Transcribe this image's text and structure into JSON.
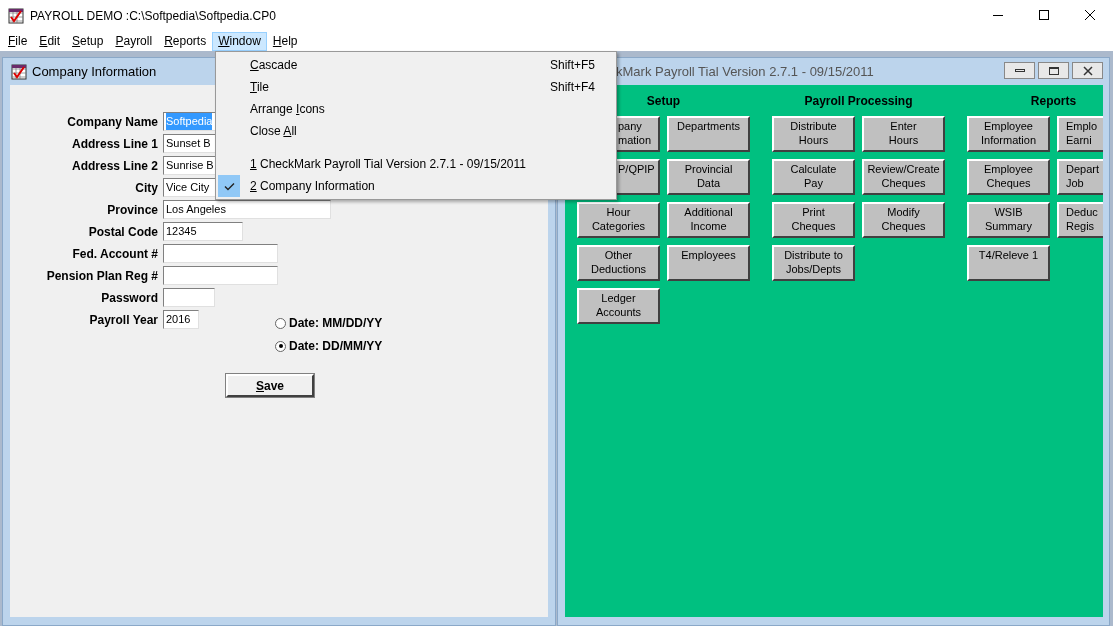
{
  "window": {
    "title": "PAYROLL DEMO :C:\\Softpedia\\Softpedia.CP0"
  },
  "menu_bar": [
    {
      "mnemonic": "F",
      "after": "ile",
      "selected": false
    },
    {
      "mnemonic": "E",
      "after": "dit",
      "selected": false
    },
    {
      "mnemonic": "S",
      "after": "etup",
      "selected": false
    },
    {
      "mnemonic": "P",
      "after": "ayroll",
      "selected": false
    },
    {
      "mnemonic": "R",
      "after": "eports",
      "selected": false
    },
    {
      "mnemonic": "W",
      "after": "indow",
      "selected": true
    },
    {
      "mnemonic": "H",
      "after": "elp",
      "selected": false
    }
  ],
  "window_menu": {
    "groups": [
      [
        {
          "mnemonic": "C",
          "after": "ascade",
          "shortcut": "Shift+F5",
          "checked": false
        },
        {
          "mnemonic": "T",
          "after": "ile",
          "shortcut": "Shift+F4",
          "checked": false
        },
        {
          "before": "Arrange ",
          "mnemonic": "I",
          "after": "cons",
          "checked": false
        },
        {
          "before": "Close ",
          "mnemonic": "A",
          "after": "ll",
          "checked": false
        }
      ],
      [
        {
          "mnemonic": "1",
          "after": " CheckMark Payroll Tial Version 2.7.1 - 09/15/2011",
          "checked": false
        },
        {
          "mnemonic": "2",
          "after": " Company Information",
          "checked": true
        }
      ]
    ]
  },
  "company_window": {
    "title": "Company Information",
    "fields": [
      {
        "label": "Company Name",
        "value": "Softpedia",
        "highlighted": true
      },
      {
        "label": "Address Line 1",
        "value": "Sunset B",
        "highlighted": false
      },
      {
        "label": "Address Line 2",
        "value": "Sunrise B",
        "highlighted": false
      },
      {
        "label": "City",
        "value": "Vice City",
        "highlighted": false
      },
      {
        "label": "Province",
        "value": "Los Angeles",
        "highlighted": false
      },
      {
        "label": "Postal Code",
        "value": "12345",
        "highlighted": false
      },
      {
        "label": "Fed. Account #"
      },
      {
        "label": "Pension Plan Reg #"
      },
      {
        "label": "Password"
      },
      {
        "label": "Payroll Year",
        "value": "2016",
        "highlighted": false
      }
    ],
    "date_formats": [
      {
        "label": "Date: MM/DD/YY",
        "selected": false
      },
      {
        "label": "Date: DD/MM/YY",
        "selected": true
      }
    ],
    "save_button": {
      "mnemonic": "S",
      "after": "ave"
    }
  },
  "main_window": {
    "title": "kMark Payroll Tial Version 2.7.1 - 09/15/2011",
    "sections": [
      {
        "heading": "Setup",
        "buttons": [
          {
            "lines": [
              "pany",
              "mation"
            ],
            "kind": "covered"
          },
          {
            "lines": [
              "Departments"
            ],
            "kind": "plain"
          },
          {
            "lines": [
              "P/QPIP"
            ],
            "kind": "covered"
          },
          {
            "lines": [
              "Provincial",
              "Data"
            ],
            "kind": "plain"
          },
          {
            "lines": [
              "Hour",
              "Categories"
            ],
            "kind": "plain"
          },
          {
            "lines": [
              "Additional",
              "Income"
            ],
            "kind": "plain"
          },
          {
            "lines": [
              "Other",
              "Deductions"
            ],
            "kind": "plain"
          },
          {
            "lines": [
              "Employees"
            ],
            "kind": "plain"
          },
          {
            "lines": [
              "Ledger",
              "Accounts"
            ],
            "kind": "plain"
          }
        ]
      },
      {
        "heading": "Payroll Processing",
        "buttons": [
          {
            "lines": [
              "Distribute",
              "Hours"
            ],
            "kind": "plain"
          },
          {
            "lines": [
              "Enter",
              "Hours"
            ],
            "kind": "plain"
          },
          {
            "lines": [
              "Calculate",
              "Pay"
            ],
            "kind": "plain"
          },
          {
            "lines": [
              "Review/Create",
              "Cheques"
            ],
            "kind": "plain"
          },
          {
            "lines": [
              "Print",
              "Cheques"
            ],
            "kind": "plain"
          },
          {
            "lines": [
              "Modify",
              "Cheques"
            ],
            "kind": "plain"
          },
          {
            "lines": [
              "Distribute to",
              "Jobs/Depts"
            ],
            "kind": "plain"
          }
        ]
      },
      {
        "heading": "Reports",
        "buttons": [
          {
            "lines": [
              "Employee",
              "Information"
            ],
            "kind": "plain"
          },
          {
            "lines": [
              "Emplo",
              "Earni"
            ],
            "kind": "cut"
          },
          {
            "lines": [
              "Employee",
              "Cheques"
            ],
            "kind": "plain"
          },
          {
            "lines": [
              "Depart",
              "Job"
            ],
            "kind": "cut"
          },
          {
            "lines": [
              "WSIB",
              "Summary"
            ],
            "kind": "plain"
          },
          {
            "lines": [
              "Deduc",
              "Regis"
            ],
            "kind": "cut"
          },
          {
            "lines": [
              "T4/Releve 1"
            ],
            "kind": "plain"
          }
        ]
      }
    ]
  }
}
